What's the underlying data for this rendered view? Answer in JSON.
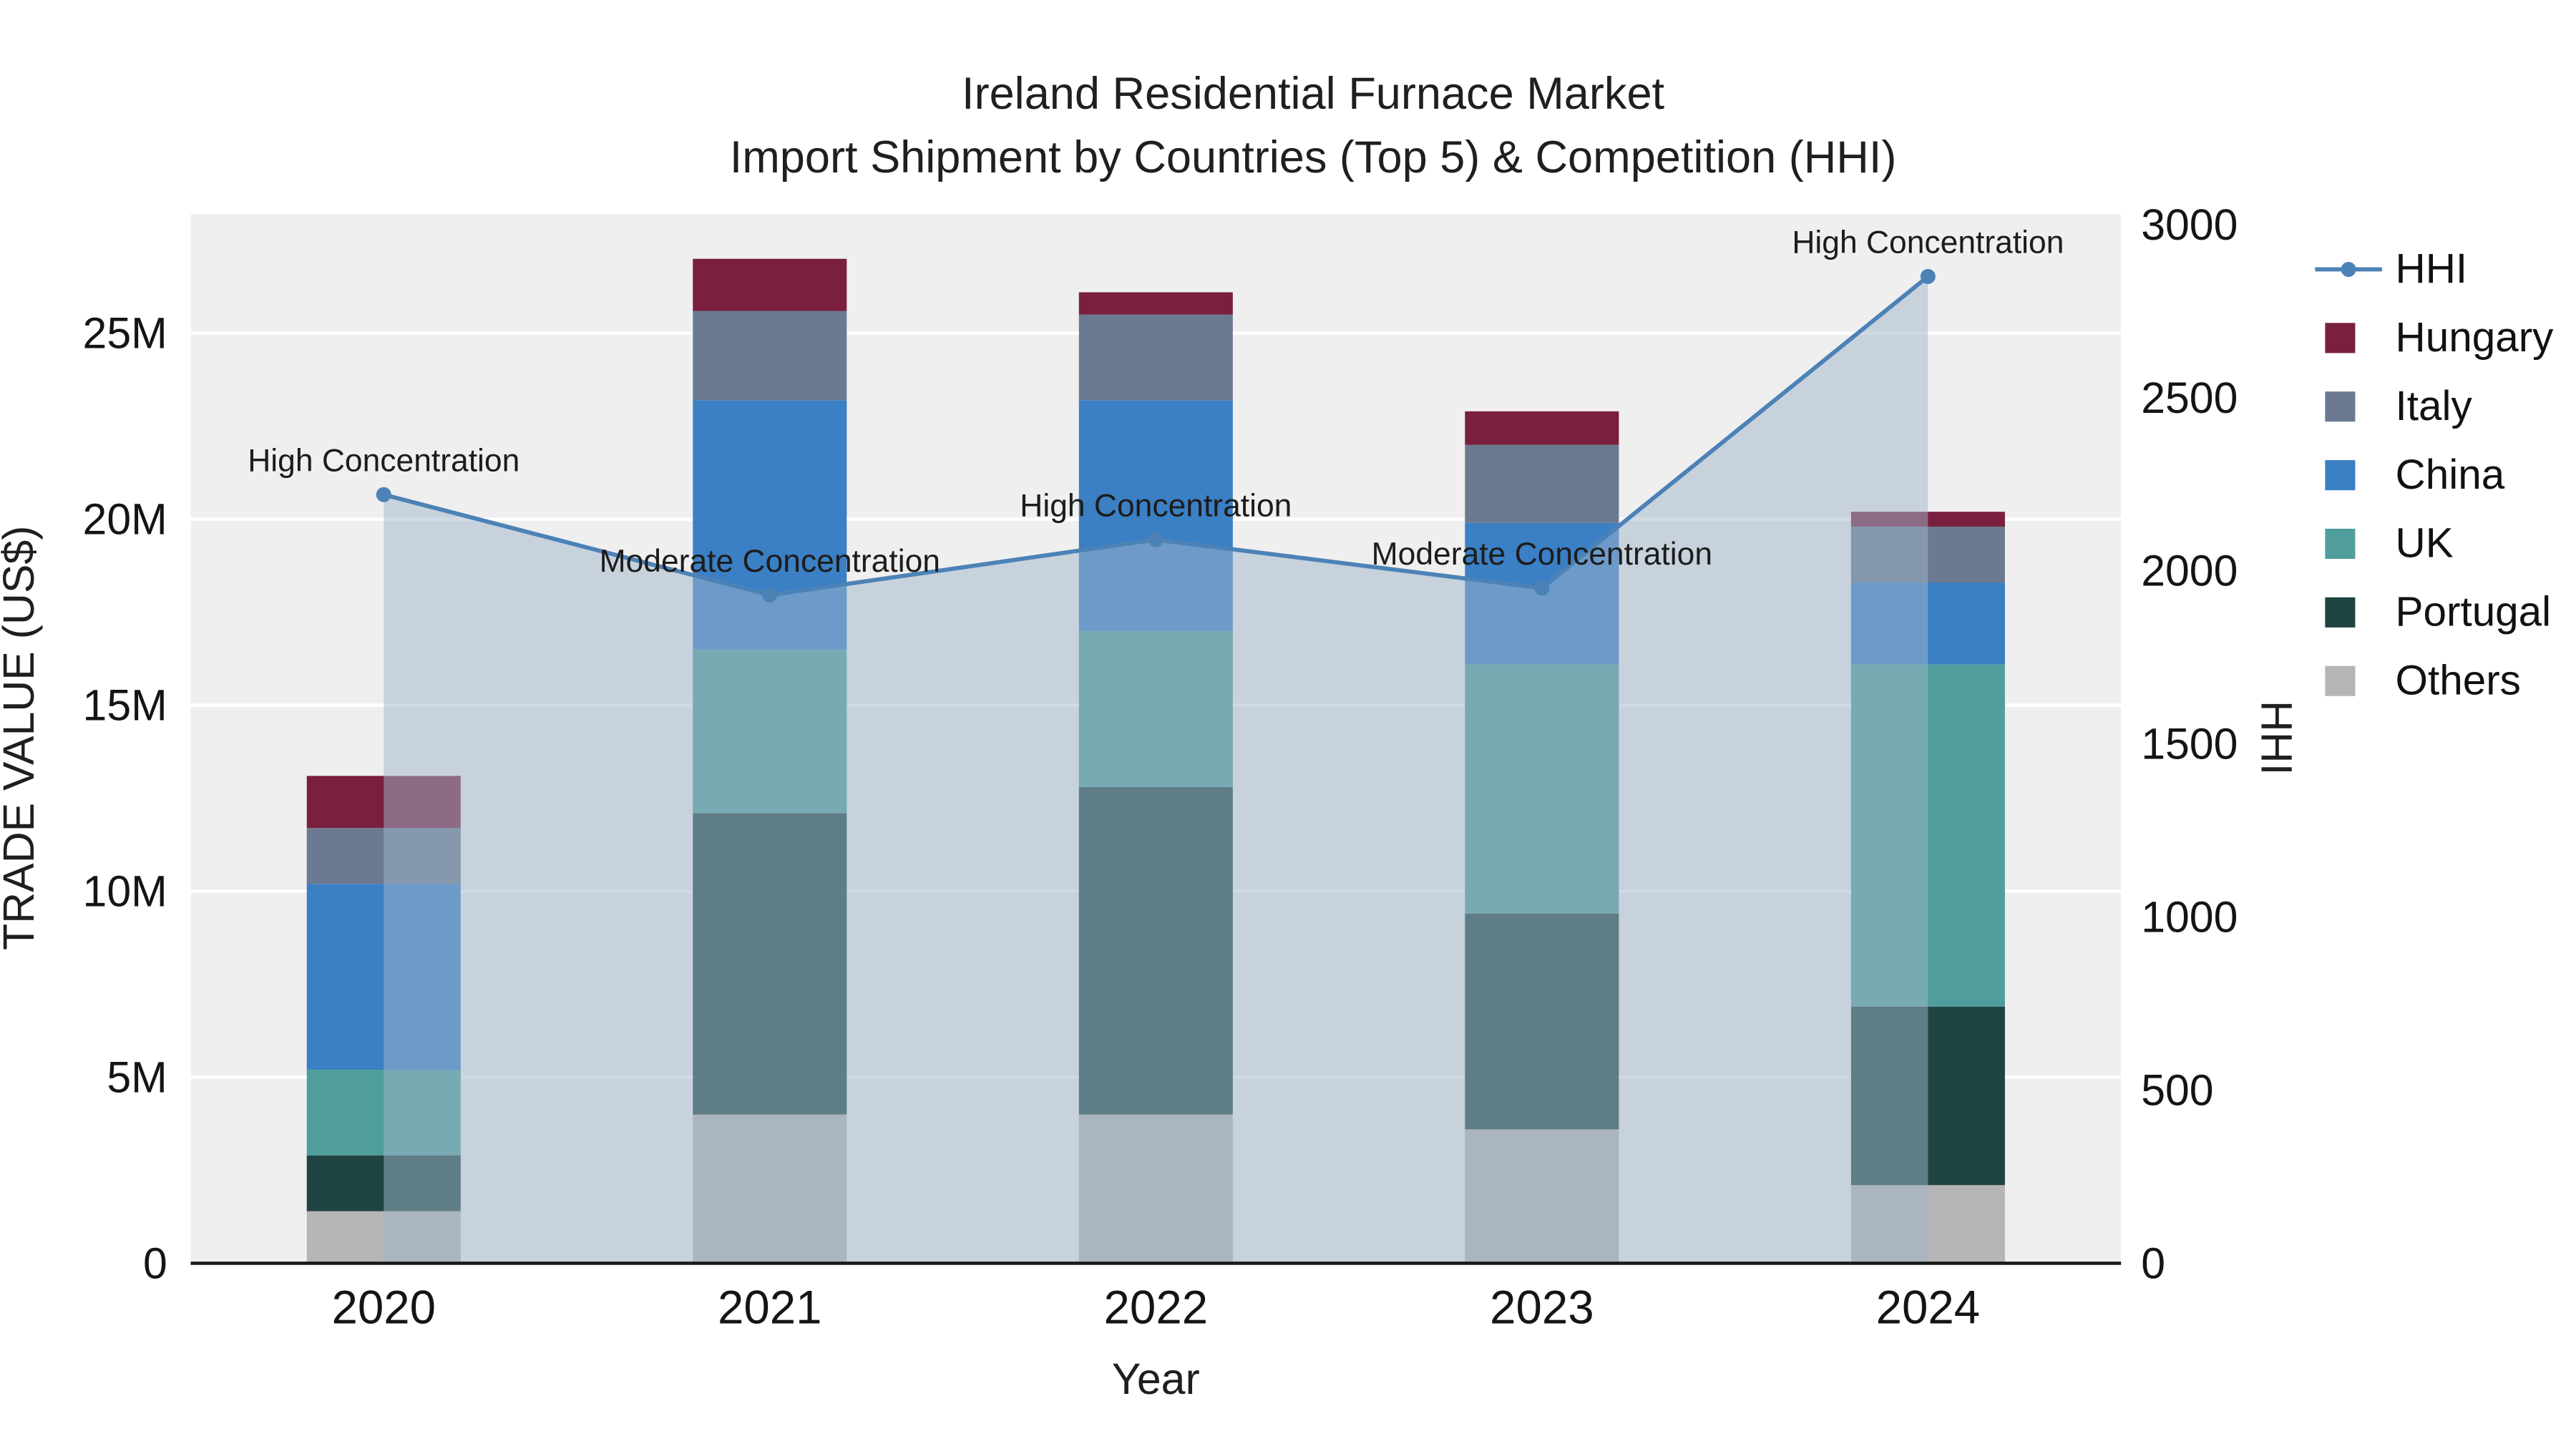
{
  "chart": {
    "title_line1": "Ireland Residential Furnace Market",
    "title_line2": "Import Shipment by Countries (Top 5) & Competition (HHI)",
    "ylabel": "TRADE VALUE (US$)",
    "y2label": "HHI",
    "xlabel": "Year"
  },
  "chart_data": {
    "type": "stacked-bar+line-area",
    "categories": [
      "2020",
      "2021",
      "2022",
      "2023",
      "2024"
    ],
    "bar_unit": "US$ millions",
    "series": [
      {
        "name": "Others",
        "color": "#b5b5b5",
        "values": [
          1.4,
          4.0,
          4.0,
          3.6,
          2.1
        ]
      },
      {
        "name": "Portugal",
        "color": "#1f4441",
        "values": [
          1.5,
          8.1,
          8.8,
          5.8,
          4.8
        ]
      },
      {
        "name": "UK",
        "color": "#4f9e9b",
        "values": [
          2.3,
          4.4,
          4.2,
          6.7,
          9.2
        ]
      },
      {
        "name": "China",
        "color": "#3b7fc4",
        "values": [
          5.0,
          6.7,
          6.2,
          3.8,
          2.2
        ]
      },
      {
        "name": "Italy",
        "color": "#6b7a91",
        "values": [
          1.5,
          2.4,
          2.3,
          2.1,
          1.5
        ]
      },
      {
        "name": "Hungary",
        "color": "#7a1f3e",
        "values": [
          1.4,
          1.4,
          0.6,
          0.9,
          0.4
        ]
      }
    ],
    "line_series": {
      "name": "HHI",
      "color": "#4c82b6",
      "fill_color": "#9fb6cc",
      "values": [
        2220,
        1930,
        2090,
        1950,
        2850
      ]
    },
    "annotations": [
      "High Concentration",
      "Moderate Concentration",
      "High Concentration",
      "Moderate Concentration",
      "High Concentration"
    ],
    "y_left": {
      "ticks": [
        0,
        5,
        10,
        15,
        20,
        25
      ],
      "tick_labels": [
        "0",
        "5M",
        "10M",
        "15M",
        "20M",
        "25M"
      ],
      "max": 28.2,
      "unit": "US$ millions"
    },
    "y_right": {
      "ticks": [
        0,
        500,
        1000,
        1500,
        2000,
        2500,
        3000
      ],
      "tick_labels": [
        "0",
        "500",
        "1000",
        "1500",
        "2000",
        "2500",
        "3000"
      ],
      "max": 3030
    },
    "legend": [
      "HHI",
      "Hungary",
      "Italy",
      "China",
      "UK",
      "Portugal",
      "Others"
    ],
    "plot_bg": "#efefef",
    "grid_color": "#ffffff",
    "axis_line_color": "#1a1a1a"
  }
}
